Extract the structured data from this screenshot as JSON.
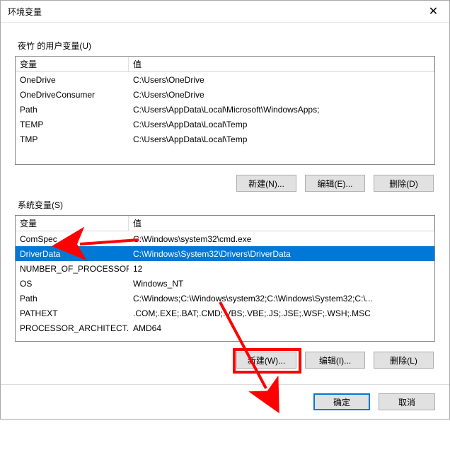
{
  "title": "环境变量",
  "close_glyph": "✕",
  "user_section": {
    "label": "夜竹 的用户变量(U)",
    "headers": {
      "var": "变量",
      "val": "值"
    },
    "rows": [
      {
        "var": "OneDrive",
        "val": "C:\\Users\\OneDrive"
      },
      {
        "var": "OneDriveConsumer",
        "val": "C:\\Users\\OneDrive"
      },
      {
        "var": "Path",
        "val": "C:\\Users\\AppData\\Local\\Microsoft\\WindowsApps;"
      },
      {
        "var": "TEMP",
        "val": "C:\\Users\\AppData\\Local\\Temp"
      },
      {
        "var": "TMP",
        "val": "C:\\Users\\AppData\\Local\\Temp"
      }
    ],
    "buttons": {
      "new": "新建(N)...",
      "edit": "编辑(E)...",
      "delete": "删除(D)"
    }
  },
  "sys_section": {
    "label": "系统变量(S)",
    "headers": {
      "var": "变量",
      "val": "值"
    },
    "selected_index": 1,
    "rows": [
      {
        "var": "ComSpec",
        "val": "C:\\Windows\\system32\\cmd.exe"
      },
      {
        "var": "DriverData",
        "val": "C:\\Windows\\System32\\Drivers\\DriverData"
      },
      {
        "var": "NUMBER_OF_PROCESSORS",
        "val": "12"
      },
      {
        "var": "OS",
        "val": "Windows_NT"
      },
      {
        "var": "Path",
        "val": "C:\\Windows;C:\\Windows\\system32;C:\\Windows\\System32;C:\\..."
      },
      {
        "var": "PATHEXT",
        "val": ".COM;.EXE;.BAT;.CMD;.VBS;.VBE;.JS;.JSE;.WSF;.WSH;.MSC"
      },
      {
        "var": "PROCESSOR_ARCHITECT...",
        "val": "AMD64"
      }
    ],
    "buttons": {
      "new": "新建(W)...",
      "edit": "编辑(I)...",
      "delete": "删除(L)"
    }
  },
  "footer": {
    "ok": "确定",
    "cancel": "取消"
  },
  "annotations": {
    "arrow_color": "#ff0000"
  }
}
